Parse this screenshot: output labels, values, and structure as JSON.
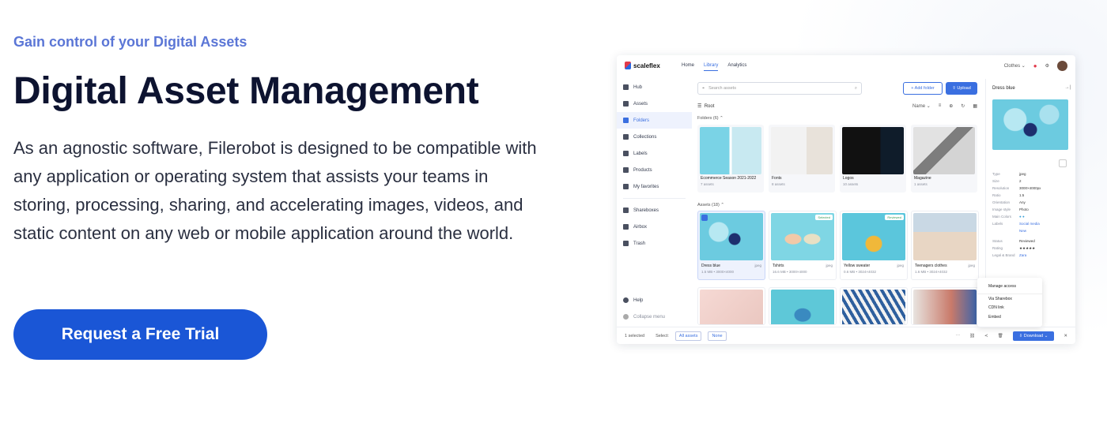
{
  "hero": {
    "eyebrow": "Gain control of your Digital Assets",
    "headline": "Digital Asset Management",
    "description": "As an agnostic software, Filerobot is designed to be compatible with any application or operating system that assists your teams in storing, processing, sharing, and accelerating images, videos, and static content on any web or mobile application around the world.",
    "cta_label": "Request a Free Trial"
  },
  "app": {
    "brand": "scaleflex",
    "nav": [
      "Home",
      "Library",
      "Analytics"
    ],
    "active_nav": "Library",
    "workspace": "Clothes",
    "sidebar": [
      {
        "label": "Hub",
        "icon": "hub-icon"
      },
      {
        "label": "Assets",
        "icon": "assets-icon"
      },
      {
        "label": "Folders",
        "icon": "folder-icon"
      },
      {
        "label": "Collections",
        "icon": "collections-icon"
      },
      {
        "label": "Labels",
        "icon": "label-icon"
      },
      {
        "label": "Products",
        "icon": "products-icon"
      },
      {
        "label": "My favorites",
        "icon": "heart-icon"
      }
    ],
    "sidebar2": [
      {
        "label": "Shareboxes",
        "icon": "share-icon"
      },
      {
        "label": "Airbox",
        "icon": "airbox-icon"
      },
      {
        "label": "Trash",
        "icon": "trash-icon"
      }
    ],
    "sidebar_bottom": [
      {
        "label": "Help",
        "icon": "help-icon"
      },
      {
        "label": "Collapse menu",
        "icon": "collapse-icon"
      }
    ],
    "search_placeholder": "Search assets",
    "add_folder": "+ Add folder",
    "upload": "Upload",
    "breadcrumb": "Root",
    "sort": "Name",
    "folders_label": "Folders (6)",
    "folders": [
      {
        "name": "Ecommerce Season 2021-2022",
        "meta": "7 assets"
      },
      {
        "name": "Fonts",
        "meta": "8 assets"
      },
      {
        "name": "Logos",
        "meta": "10 assets"
      },
      {
        "name": "Magazine",
        "meta": "1 assets"
      }
    ],
    "assets_label": "Assets (18)",
    "assets": [
      {
        "name": "Dress blue",
        "type": "jpeg",
        "meta": "1.5 MB • 3000×4000"
      },
      {
        "name": "Tshirts",
        "type": "jpeg",
        "meta": "16.6 MB • 3000×4000",
        "badge": "Selected"
      },
      {
        "name": "Yellow sweater",
        "type": "jpeg",
        "meta": "0.6 MB • 3024×4032",
        "badge": "Reviewed"
      },
      {
        "name": "Teenagers clothes",
        "type": "jpeg",
        "meta": "1.6 MB • 3024×4032"
      }
    ],
    "panel": {
      "title": "Dress blue",
      "rows": [
        {
          "k": "Type",
          "v": "jpeg"
        },
        {
          "k": "Size",
          "v": "2"
        },
        {
          "k": "Resolution",
          "v": "3000×4000px"
        },
        {
          "k": "Ratio",
          "v": "1.5"
        },
        {
          "k": "Orientation",
          "v": "Any"
        },
        {
          "k": "Image style",
          "v": "Photo"
        },
        {
          "k": "Main Colors",
          "v": "● ●"
        },
        {
          "k": "Labels",
          "v": "Social media"
        },
        {
          "k": "",
          "v": "New"
        },
        {
          "k": "Status",
          "v": "Reviewed"
        },
        {
          "k": "Rating",
          "v": "★★★★★"
        },
        {
          "k": "Legal & Brand",
          "v": "Zara"
        }
      ]
    },
    "menu": [
      "Manage access",
      "Via Sharebox",
      "CDN link",
      "Embed"
    ],
    "footer": {
      "selected": "1 selected",
      "select_label": "Select:",
      "all": "All assets",
      "none": "None",
      "download": "Download"
    }
  },
  "colors": {
    "accent": "#1a56d6",
    "eyebrow": "#5b76d6",
    "app_accent": "#3a6fe0"
  }
}
